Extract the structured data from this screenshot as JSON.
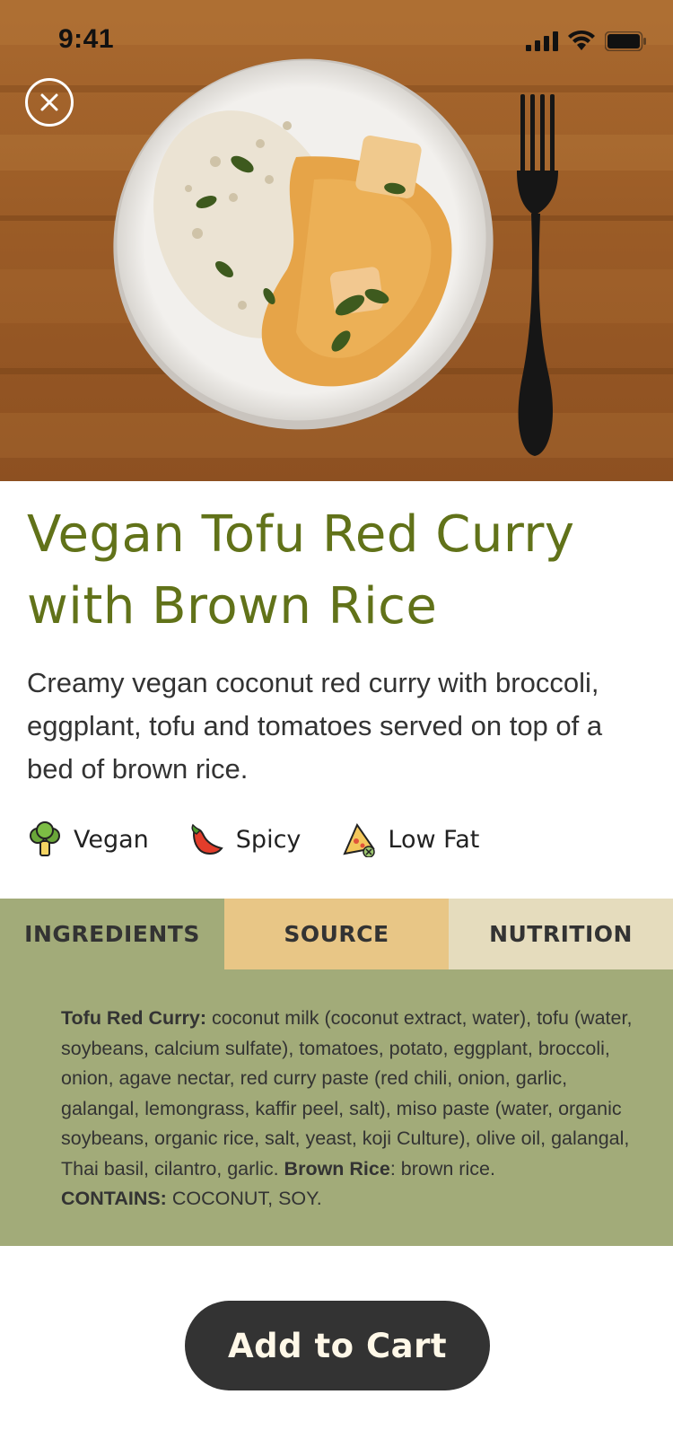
{
  "status_bar": {
    "time": "9:41"
  },
  "product": {
    "title": "Vegan Tofu Red Curry with Brown Rice",
    "description": "Creamy vegan coconut red curry with broccoli, eggplant, tofu and tomatoes served on top of a bed of brown rice."
  },
  "tags": [
    {
      "label": "Vegan",
      "icon": "broccoli-icon"
    },
    {
      "label": "Spicy",
      "icon": "chili-pepper-icon"
    },
    {
      "label": "Low Fat",
      "icon": "pizza-slice-icon"
    }
  ],
  "tabs": [
    {
      "label": "INGREDIENTS",
      "active": true
    },
    {
      "label": "SOURCE",
      "active": false
    },
    {
      "label": "NUTRITION",
      "active": false
    }
  ],
  "ingredients": {
    "curry_heading": "Tofu Red Curry:",
    "curry_text": " coconut milk (coconut extract, water), tofu (water, soybeans, calcium sulfate), tomatoes, potato, eggplant, broccoli, onion, agave nectar, red curry paste (red chili, onion, garlic, galangal, lemongrass, kaffir peel, salt), miso paste (water, organic soybeans, organic rice, salt, yeast, koji Culture), olive oil, galangal, Thai basil, cilantro, garlic. ",
    "rice_heading": "Brown Rice",
    "rice_text": ": brown rice.",
    "contains_heading": "CONTAINS:",
    "contains_text": " COCONUT, SOY."
  },
  "cart": {
    "label": "Add to Cart"
  },
  "colors": {
    "title": "#617219",
    "tab_ingredients": "#a2ab79",
    "tab_source": "#e8c686",
    "tab_nutrition": "#e5dcbd",
    "cart_button": "#333333"
  }
}
